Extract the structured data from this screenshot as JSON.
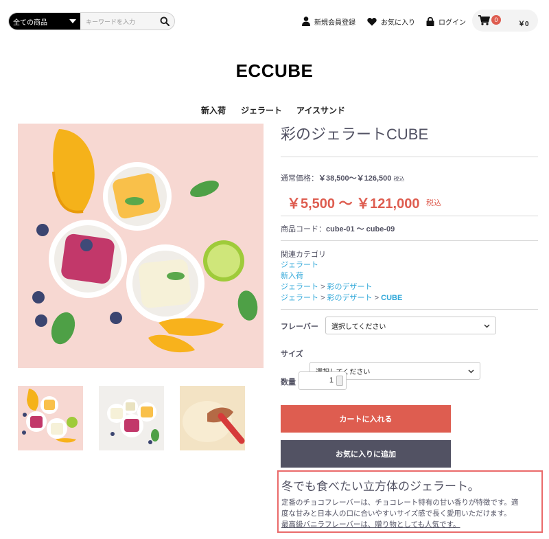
{
  "header": {
    "category_select": "全ての商品",
    "search_placeholder": "キーワードを入力",
    "register": "新規会員登録",
    "favorites": "お気に入り",
    "login": "ログイン",
    "cart_count": "0",
    "cart_total": "￥0"
  },
  "logo": "ECCUBE",
  "nav": [
    "新入荷",
    "ジェラート",
    "アイスサンド"
  ],
  "product": {
    "title": "彩のジェラートCUBE",
    "regular_price_label": "通常価格：",
    "regular_price": "￥38,500～￥126,500",
    "regular_tax": "税込",
    "sale_price": "￥5,500 ～ ￥121,000",
    "sale_tax": "税込",
    "code_label": "商品コード：",
    "code": "cube-01 ～ cube-09",
    "related_heading": "関連カテゴリ",
    "categories": {
      "c1": "ジェラート",
      "c2": "新入荷",
      "c3a": "ジェラート",
      "c3b": "彩のデザート",
      "c4a": "ジェラート",
      "c4b": "彩のデザート",
      "c4c": "CUBE",
      "sep": ">"
    },
    "flavor_label": "フレーバー",
    "flavor_value": "選択してください",
    "size_label": "サイズ",
    "size_value": "選択してください",
    "qty_label": "数量",
    "qty_value": "1",
    "add_to_cart": "カートに入れる",
    "add_to_favorites": "お気に入りに追加",
    "description_title": "冬でも食べたい立方体のジェラート。",
    "description_line1": "定番のチョコフレーバーは、チョコレート特有の甘い香りが特徴です。適",
    "description_line2": "度な甘みと日本人の口に合いやすいサイズ感で長く愛用いただけます。",
    "description_line3": "最高級バニラフレーバーは、贈り物としても人気です。"
  },
  "colors": {
    "accent": "#de5d50",
    "dark_button": "#525263",
    "link": "#2fa7d9",
    "highlight_border": "#ea6a6a"
  },
  "icons": [
    "search-icon",
    "user-icon",
    "heart-icon",
    "lock-icon",
    "cart-icon",
    "caret-down-icon"
  ]
}
